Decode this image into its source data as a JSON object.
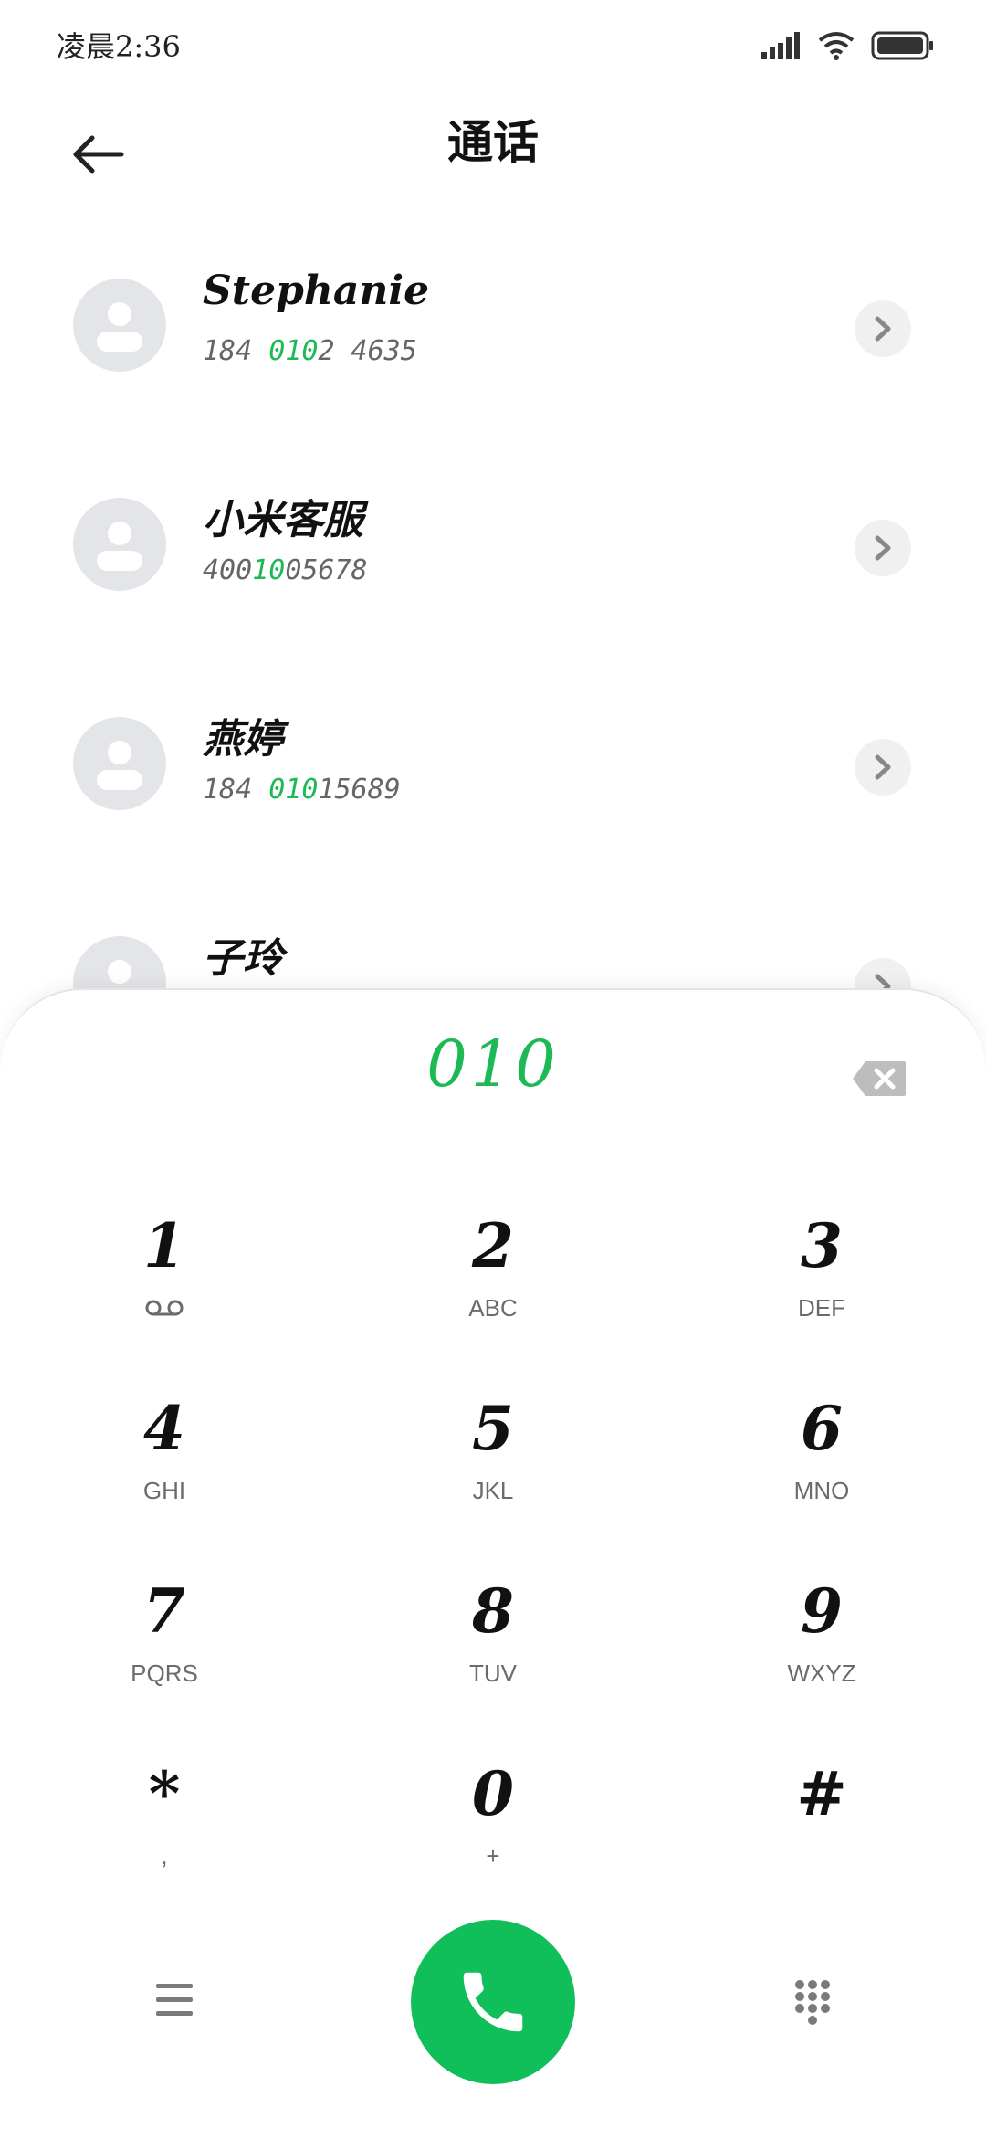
{
  "status_bar": {
    "time": "凌晨2:36"
  },
  "header": {
    "title": "通话"
  },
  "contacts": [
    {
      "name": "Stephanie",
      "number_pre": "184 ",
      "number_match": "010",
      "number_post": "2 4635"
    },
    {
      "name": "小米客服",
      "number_pre": "400",
      "number_match": "10",
      "number_post": "05678"
    },
    {
      "name": "燕婷",
      "number_pre": "184 ",
      "number_match": "010",
      "number_post": "15689"
    },
    {
      "name": "子玲",
      "number_pre": "",
      "number_match": "",
      "number_post": ""
    }
  ],
  "dialpad": {
    "input": "010",
    "keys": [
      {
        "digit": "1",
        "letters": ""
      },
      {
        "digit": "2",
        "letters": "ABC"
      },
      {
        "digit": "3",
        "letters": "DEF"
      },
      {
        "digit": "4",
        "letters": "GHI"
      },
      {
        "digit": "5",
        "letters": "JKL"
      },
      {
        "digit": "6",
        "letters": "MNO"
      },
      {
        "digit": "7",
        "letters": "PQRS"
      },
      {
        "digit": "8",
        "letters": "TUV"
      },
      {
        "digit": "9",
        "letters": "WXYZ"
      },
      {
        "digit": "*",
        "letters": ","
      },
      {
        "digit": "0",
        "letters": "+"
      },
      {
        "digit": "#",
        "letters": ""
      }
    ]
  },
  "colors": {
    "accent": "#1db954",
    "call_button": "#10bf5a"
  },
  "icons": {
    "back": "arrow-left-icon",
    "detail": "chevron-right-icon",
    "backspace": "backspace-icon",
    "voicemail": "voicemail-icon",
    "menu": "menu-icon",
    "call": "phone-icon",
    "hide_dialpad": "dialpad-grid-icon"
  }
}
